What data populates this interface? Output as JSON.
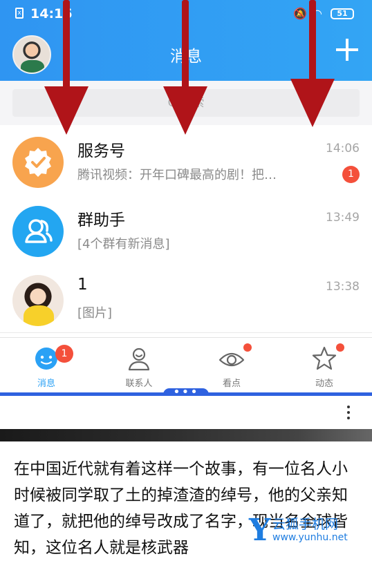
{
  "status_bar": {
    "time": "14:16",
    "sim_label": "x",
    "battery": "51"
  },
  "header": {
    "title": "消息"
  },
  "search": {
    "placeholder": "Q 搜索"
  },
  "conversations": [
    {
      "name": "服务号",
      "preview": "腾讯视频：开年口碑最高的剧！把…",
      "time": "14:06",
      "badge": "1"
    },
    {
      "name": "群助手",
      "preview": "[4个群有新消息]",
      "time": "13:49"
    },
    {
      "name": "1",
      "preview": "[图片]",
      "time": "13:38"
    }
  ],
  "tabs": [
    {
      "label": "消息",
      "badge": "1"
    },
    {
      "label": "联系人"
    },
    {
      "label": "看点"
    },
    {
      "label": "动态"
    }
  ],
  "split_handle": "•••",
  "article": {
    "text": "在中国近代就有着这样一个故事，有一位名人小时候被同学取了土的掉渣渣的绰号，他的父亲知道了，就把他的绰号改成了名字，现当名全球皆知，这位名人就是核武器"
  },
  "watermark": {
    "name": "云狐手机网",
    "url": "www.yunhu.net"
  },
  "colors": {
    "header_blue": "#2f95f2",
    "badge_red": "#f4503b",
    "arrow_red": "#b01419",
    "tab_active": "#2aa1f5"
  }
}
